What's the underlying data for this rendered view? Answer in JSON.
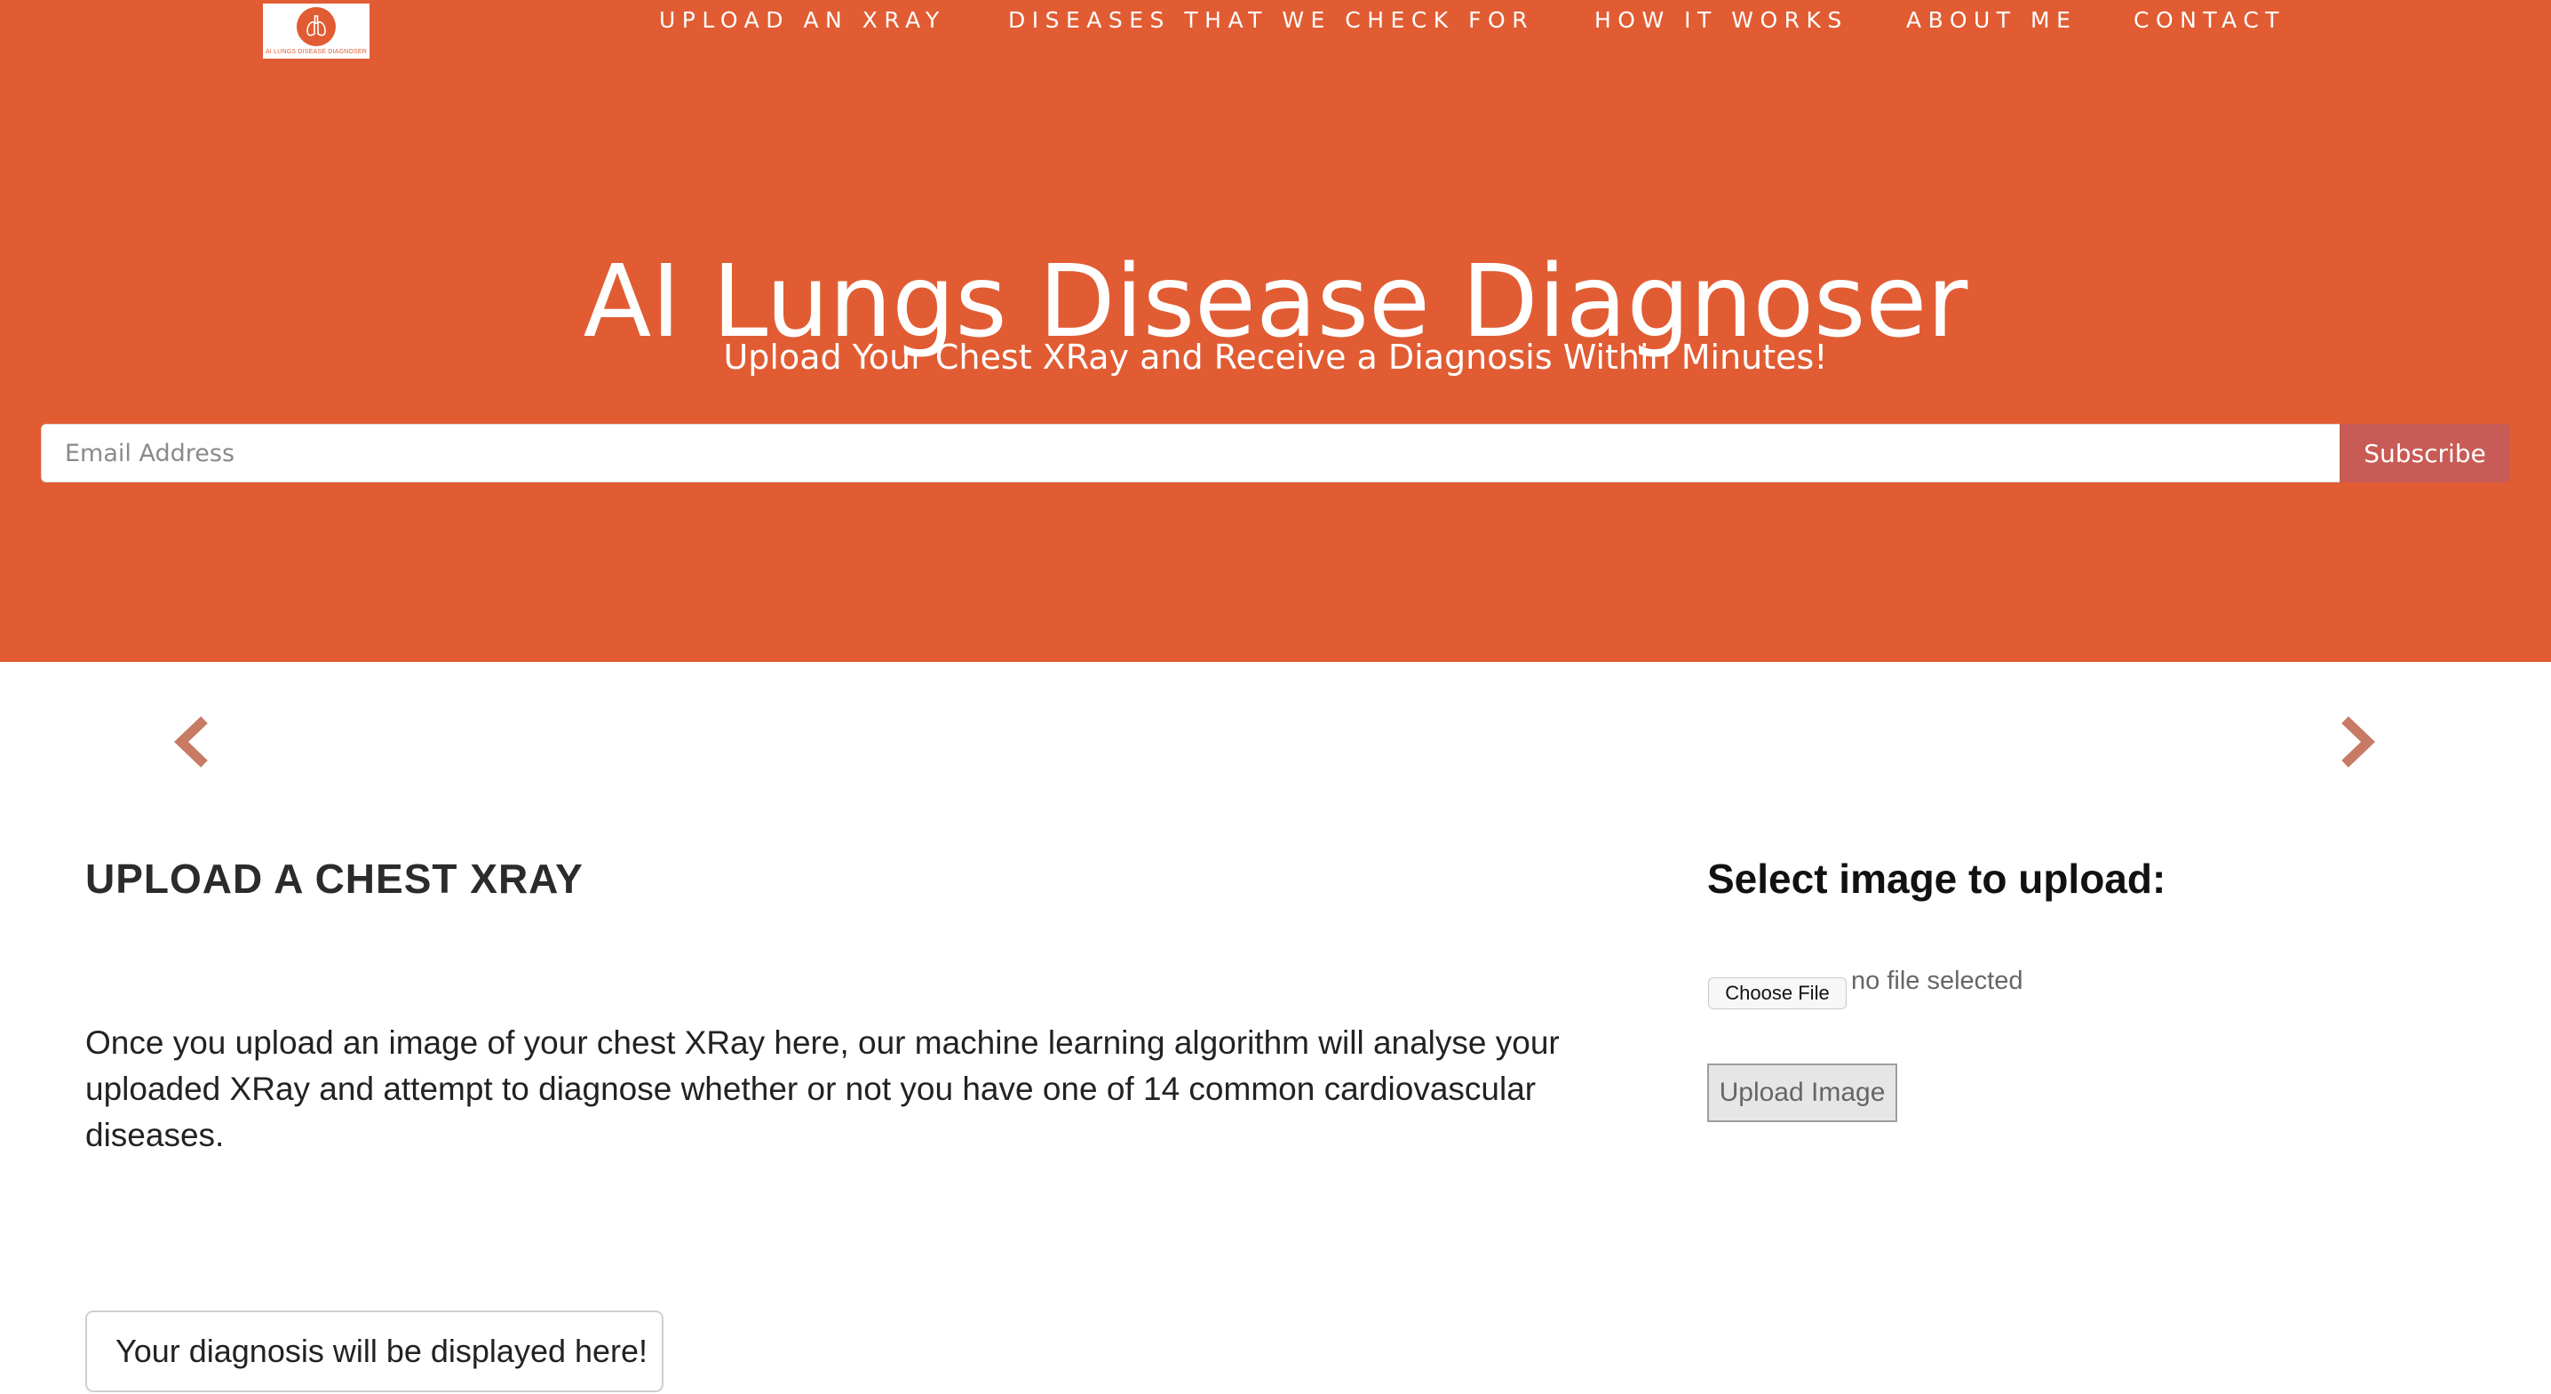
{
  "brand": {
    "logo_text": "AI LUNGS DISEASE DIAGNOSER",
    "accent_color": "#e15c33"
  },
  "nav": {
    "items": [
      {
        "label": "UPLOAD AN XRAY"
      },
      {
        "label": "DISEASES THAT WE CHECK FOR"
      },
      {
        "label": "HOW IT WORKS"
      },
      {
        "label": "ABOUT ME"
      },
      {
        "label": "CONTACT"
      }
    ]
  },
  "hero": {
    "title": "AI Lungs Disease Diagnoser",
    "subtitle": "Upload Your Chest XRay and Receive a Diagnosis Within Minutes!",
    "email_placeholder": "Email Address",
    "email_value": "",
    "subscribe_label": "Subscribe",
    "subscribe_color": "#c85b55"
  },
  "carousel": {
    "prev_icon": "chevron-left-icon",
    "next_icon": "chevron-right-icon",
    "arrow_color": "#c77a64"
  },
  "upload_section": {
    "heading": "UPLOAD A CHEST XRAY",
    "description": "Once you upload an image of your chest XRay here, our machine learning algorithm will analyse your uploaded XRay and attempt to diagnose whether or not you have one of 14 common cardiovascular diseases.",
    "diagnosis_placeholder": "Your diagnosis will be displayed here!"
  },
  "upload_form": {
    "heading": "Select image to upload:",
    "choose_file_label": "Choose File",
    "file_status": "no file selected",
    "upload_button_label": "Upload Image"
  }
}
